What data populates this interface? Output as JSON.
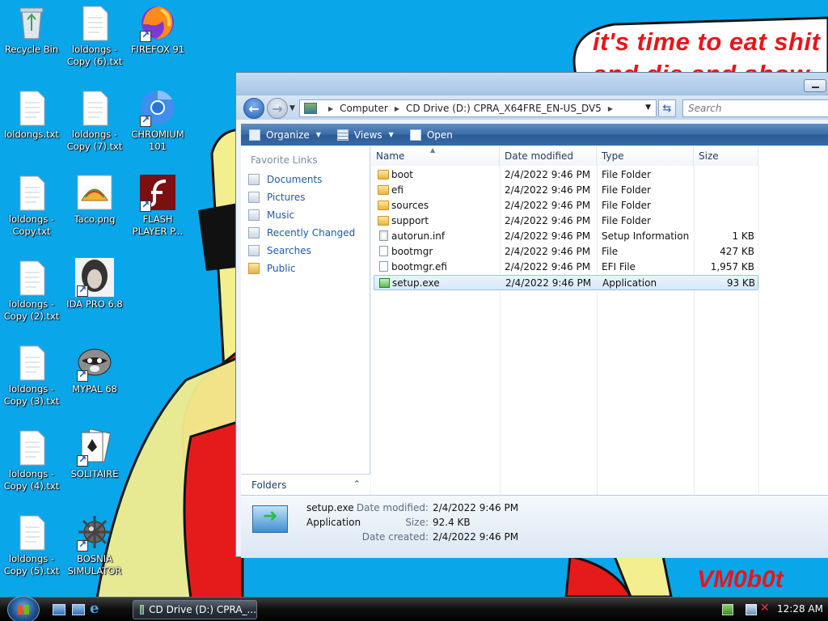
{
  "wallpaper": {
    "text_line1": "it's time to eat shit",
    "text_line2": "and die and show",
    "signature": "VM0b0t"
  },
  "desktop_icons": [
    {
      "label": "Recycle Bin",
      "icon": "recycle-bin-icon"
    },
    {
      "label": "loldongs - Copy (6).txt",
      "icon": "text-file-icon"
    },
    {
      "label": "FIREFOX 91",
      "icon": "firefox-icon"
    },
    {
      "label": "loldongs.txt",
      "icon": "text-file-icon"
    },
    {
      "label": "loldongs - Copy (7).txt",
      "icon": "text-file-icon"
    },
    {
      "label": "CHROMIUM 101",
      "icon": "chromium-icon"
    },
    {
      "label": "loldongs - Copy.txt",
      "icon": "text-file-icon"
    },
    {
      "label": "Taco.png",
      "icon": "taco-image-icon"
    },
    {
      "label": "FLASH PLAYER P...",
      "icon": "flash-player-icon"
    },
    {
      "label": "loldongs - Copy (2).txt",
      "icon": "text-file-icon"
    },
    {
      "label": "IDA PRO 6.8",
      "icon": "ida-pro-icon"
    },
    {
      "label": "loldongs - Copy (3).txt",
      "icon": "text-file-icon"
    },
    {
      "label": "MYPAL 68",
      "icon": "mypal-icon"
    },
    {
      "label": "loldongs - Copy (4).txt",
      "icon": "text-file-icon"
    },
    {
      "label": "SOLITAIRE",
      "icon": "solitaire-icon"
    },
    {
      "label": "loldongs - Copy (5).txt",
      "icon": "text-file-icon"
    },
    {
      "label": "BOSNIA SIMULATOR",
      "icon": "minesweeper-icon"
    }
  ],
  "explorer": {
    "address": {
      "crumbs": [
        "Computer",
        "CD Drive (D:) CPRA_X64FRE_EN-US_DV5"
      ]
    },
    "search_placeholder": "Search",
    "toolbar": {
      "organize": "Organize",
      "views": "Views",
      "open": "Open"
    },
    "nav": {
      "header": "Favorite Links",
      "links": [
        "Documents",
        "Pictures",
        "Music",
        "Recently Changed",
        "Searches",
        "Public"
      ],
      "folders_label": "Folders"
    },
    "columns": {
      "name": "Name",
      "date": "Date modified",
      "type": "Type",
      "size": "Size"
    },
    "files": [
      {
        "name": "boot",
        "date": "2/4/2022 9:46 PM",
        "type": "File Folder",
        "size": "",
        "kind": "folder"
      },
      {
        "name": "efi",
        "date": "2/4/2022 9:46 PM",
        "type": "File Folder",
        "size": "",
        "kind": "folder"
      },
      {
        "name": "sources",
        "date": "2/4/2022 9:46 PM",
        "type": "File Folder",
        "size": "",
        "kind": "folder"
      },
      {
        "name": "support",
        "date": "2/4/2022 9:46 PM",
        "type": "File Folder",
        "size": "",
        "kind": "folder"
      },
      {
        "name": "autorun.inf",
        "date": "2/4/2022 9:46 PM",
        "type": "Setup Information",
        "size": "1 KB",
        "kind": "inf"
      },
      {
        "name": "bootmgr",
        "date": "2/4/2022 9:46 PM",
        "type": "File",
        "size": "427 KB",
        "kind": "doc"
      },
      {
        "name": "bootmgr.efi",
        "date": "2/4/2022 9:46 PM",
        "type": "EFI File",
        "size": "1,957 KB",
        "kind": "doc"
      },
      {
        "name": "setup.exe",
        "date": "2/4/2022 9:46 PM",
        "type": "Application",
        "size": "93 KB",
        "kind": "app",
        "selected": true
      }
    ],
    "details": {
      "name": "setup.exe",
      "type": "Application",
      "date_modified_label": "Date modified:",
      "date_modified": "2/4/2022 9:46 PM",
      "size_label": "Size:",
      "size": "92.4 KB",
      "date_created_label": "Date created:",
      "date_created": "2/4/2022 9:46 PM"
    }
  },
  "taskbar": {
    "task_button": "CD Drive (D:) CPRA_...",
    "clock": "12:28 AM"
  }
}
